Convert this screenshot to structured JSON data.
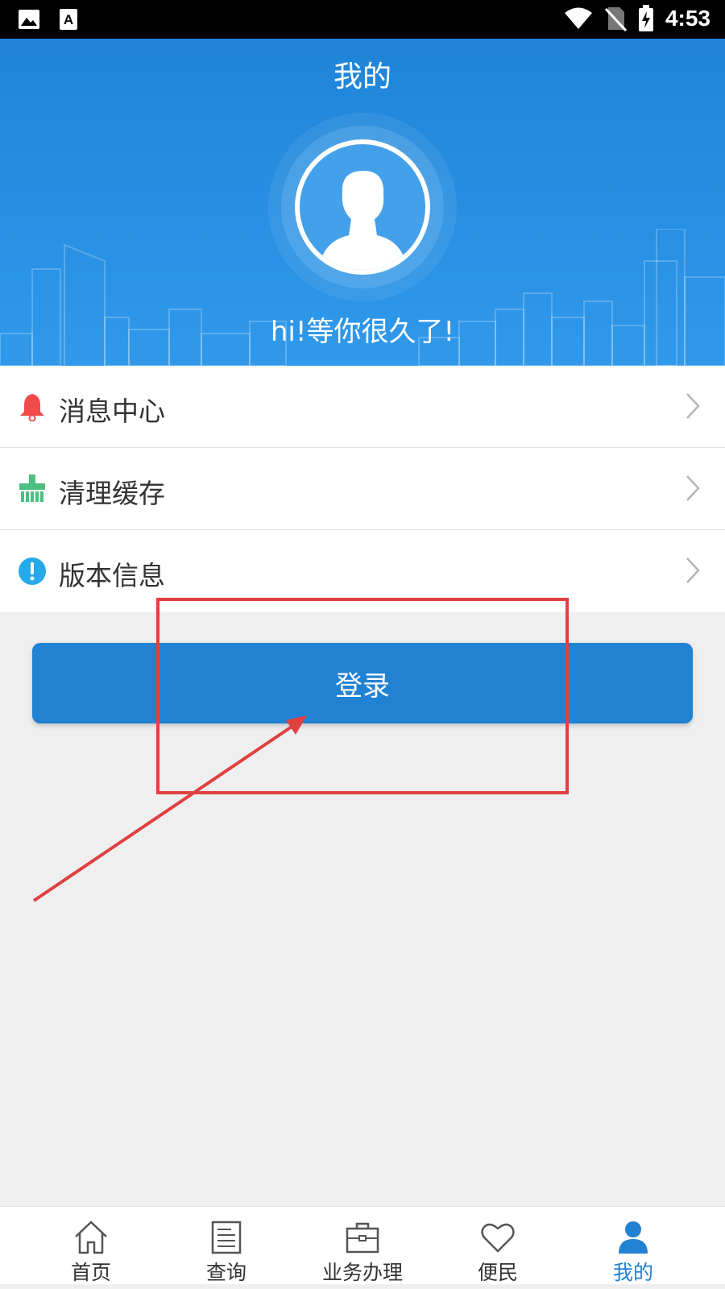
{
  "status_bar": {
    "time": "4:53",
    "icons": [
      "image-icon",
      "text-a-icon",
      "wifi-icon",
      "no-sim-icon",
      "battery-charging-icon"
    ]
  },
  "header": {
    "title": "我的",
    "greeting": "hi!等你很久了!"
  },
  "menu": {
    "items": [
      {
        "label": "消息中心",
        "icon": "bell-icon",
        "color": "#f04a4a"
      },
      {
        "label": "清理缓存",
        "icon": "broom-icon",
        "color": "#4cbf7e"
      },
      {
        "label": "版本信息",
        "icon": "info-icon",
        "color": "#26a9e8"
      }
    ]
  },
  "login": {
    "label": "登录"
  },
  "tabbar": {
    "items": [
      {
        "label": "首页",
        "icon": "home-icon"
      },
      {
        "label": "查询",
        "icon": "document-icon"
      },
      {
        "label": "业务办理",
        "icon": "briefcase-icon"
      },
      {
        "label": "便民",
        "icon": "heart-icon"
      },
      {
        "label": "我的",
        "icon": "user-icon",
        "active": true
      }
    ]
  },
  "colors": {
    "primary": "#2181d3",
    "annotation": "#e04040"
  }
}
